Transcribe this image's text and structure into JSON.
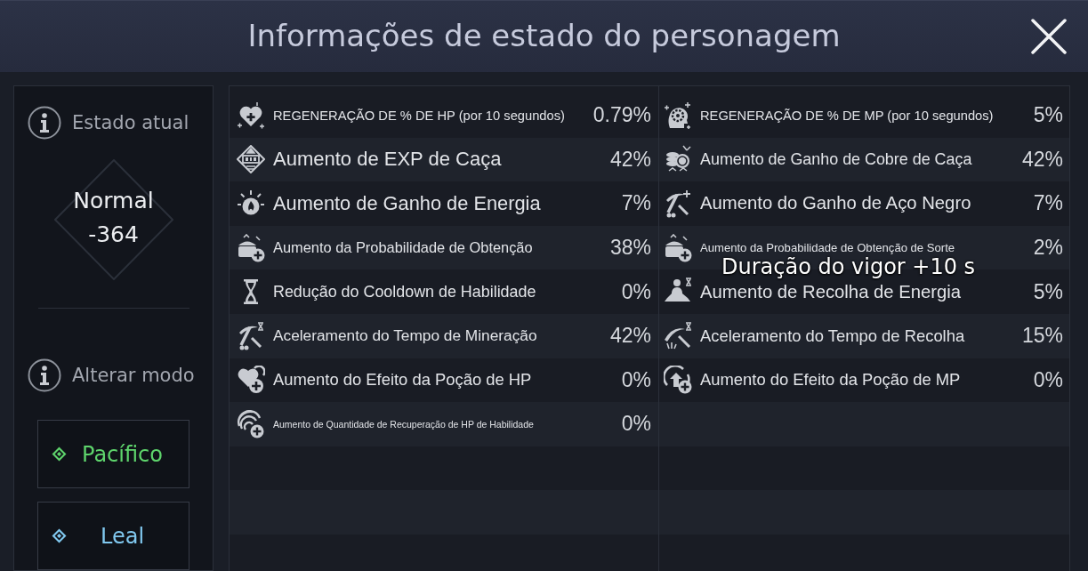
{
  "window": {
    "title": "Informações de estado do personagem"
  },
  "current_state": {
    "heading": "Estado atual",
    "state": "Normal",
    "value": "-364"
  },
  "change_mode": {
    "heading": "Alterar modo",
    "modes": [
      {
        "label": "Pacífico",
        "color": "#5ed46c"
      },
      {
        "label": "Leal",
        "color": "#80c8ef"
      }
    ]
  },
  "stats": {
    "left": [
      {
        "label": "REGENERAÇÃO DE % DE HP (por 10 segundos)",
        "value": "0.79%"
      },
      {
        "label": "Aumento de EXP de Caça",
        "value": "42%"
      },
      {
        "label": "Aumento de Ganho de Energia",
        "value": "7%"
      },
      {
        "label": "Aumento da Probabilidade de Obtenção",
        "value": "38%"
      },
      {
        "label": "Redução do Cooldown de Habilidade",
        "value": "0%"
      },
      {
        "label": "Aceleramento do Tempo de Mineração",
        "value": "42%"
      },
      {
        "label": "Aumento do Efeito da Poção de HP",
        "value": "0%"
      },
      {
        "label": "Aumento de Quantidade de Recuperação de HP de Habilidade",
        "value": "0%"
      }
    ],
    "right": [
      {
        "label": "REGENERAÇÃO DE % DE MP (por 10 segundos)",
        "value": "5%"
      },
      {
        "label": "Aumento de Ganho de Cobre de Caça",
        "value": "42%"
      },
      {
        "label": "Aumento do Ganho de Aço Negro",
        "value": "7%"
      },
      {
        "label": "Aumento da Probabilidade de Obtenção de Sorte",
        "value": "2%"
      },
      {
        "label": "Aumento de Recolha de Energia",
        "value": "5%"
      },
      {
        "label": "Aceleramento do Tempo de Recolha",
        "value": "15%"
      },
      {
        "label": "Aumento do Efeito da Poção de MP",
        "value": "0%"
      }
    ]
  },
  "toast": {
    "text": "Duração do vigor +10 s"
  }
}
